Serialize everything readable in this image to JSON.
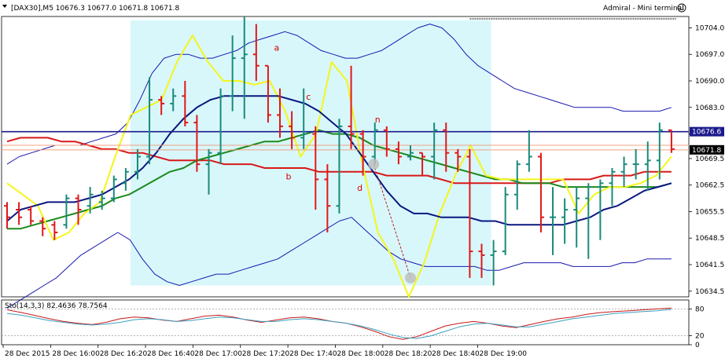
{
  "window": {
    "title": "[DAX30],M5  10676.3 10677.0 10671.8 10671.8",
    "terminal_label": "Admiral - Mini terminal"
  },
  "colors": {
    "up_candle": "#1a8a7a",
    "down_candle": "#e01818",
    "highlight": "#d8f7fb",
    "bb": "#1818b0",
    "ma_navy": "#0a1880",
    "ma_red": "#d81818",
    "ma_green": "#1a8a1a",
    "ma_yellow": "#f5f51a",
    "hline_navy": "#1a1a8c",
    "hline_salmon": "#f0a080",
    "sto_main": "#c81818",
    "sto_signal": "#3aa0c0",
    "grid": "#9a9a9a"
  },
  "chart_data": [
    {
      "type": "candlestick",
      "symbol": "DAX30",
      "timeframe": "M5",
      "ylim": [
        10633,
        10707
      ],
      "yticks": [
        10704.0,
        10697.0,
        10690.0,
        10683.0,
        10676.0,
        10669.5,
        10662.5,
        10655.5,
        10648.5,
        10641.5,
        10634.5
      ],
      "xticks": [
        {
          "label": "28 Dec 2015",
          "index": 0
        },
        {
          "label": "28 Dec 16:00",
          "index": 4
        },
        {
          "label": "28 Dec 16:20",
          "index": 8
        },
        {
          "label": "28 Dec 16:40",
          "index": 12
        },
        {
          "label": "28 Dec 17:00",
          "index": 16
        },
        {
          "label": "28 Dec 17:20",
          "index": 20
        },
        {
          "label": "28 Dec 17:40",
          "index": 24
        },
        {
          "label": "28 Dec 18:00",
          "index": 28
        },
        {
          "label": "28 Dec 18:20",
          "index": 32
        },
        {
          "label": "28 Dec 18:40",
          "index": 36
        },
        {
          "label": "28 Dec 19:00",
          "index": 40
        }
      ],
      "candles": [
        {
          "o": 10657,
          "h": 10658,
          "l": 10651,
          "c": 10654
        },
        {
          "o": 10656,
          "h": 10658,
          "l": 10652,
          "c": 10654
        },
        {
          "o": 10656,
          "h": 10657,
          "l": 10652,
          "c": 10653
        },
        {
          "o": 10653,
          "h": 10654,
          "l": 10649,
          "c": 10651
        },
        {
          "o": 10652,
          "h": 10653,
          "l": 10648,
          "c": 10650
        },
        {
          "o": 10652,
          "h": 10660,
          "l": 10651,
          "c": 10659
        },
        {
          "o": 10659,
          "h": 10660,
          "l": 10652,
          "c": 10656
        },
        {
          "o": 10657,
          "h": 10662,
          "l": 10655,
          "c": 10660
        },
        {
          "o": 10658,
          "h": 10661,
          "l": 10656,
          "c": 10659
        },
        {
          "o": 10659,
          "h": 10665,
          "l": 10658,
          "c": 10664
        },
        {
          "o": 10663,
          "h": 10667,
          "l": 10661,
          "c": 10666
        },
        {
          "o": 10666,
          "h": 10672,
          "l": 10664,
          "c": 10670
        },
        {
          "o": 10670,
          "h": 10691,
          "l": 10668,
          "c": 10685
        },
        {
          "o": 10685,
          "h": 10686,
          "l": 10681,
          "c": 10684
        },
        {
          "o": 10684,
          "h": 10688,
          "l": 10682,
          "c": 10686
        },
        {
          "o": 10686,
          "h": 10690,
          "l": 10678,
          "c": 10679
        },
        {
          "o": 10679,
          "h": 10681,
          "l": 10666,
          "c": 10668
        },
        {
          "o": 10668,
          "h": 10672,
          "l": 10660,
          "c": 10671
        },
        {
          "o": 10671,
          "h": 10688,
          "l": 10668,
          "c": 10686
        },
        {
          "o": 10686,
          "h": 10702,
          "l": 10682,
          "c": 10696
        },
        {
          "o": 10696,
          "h": 10707,
          "l": 10680,
          "c": 10697
        },
        {
          "o": 10697,
          "h": 10705,
          "l": 10690,
          "c": 10694
        },
        {
          "o": 10694,
          "h": 10694,
          "l": 10679,
          "c": 10681
        },
        {
          "o": 10681,
          "h": 10688,
          "l": 10675,
          "c": 10678
        },
        {
          "o": 10678,
          "h": 10682,
          "l": 10672,
          "c": 10675
        }
      ],
      "candles_right": [
        {
          "o": 10675,
          "h": 10688,
          "l": 10672,
          "c": 10676
        },
        {
          "o": 10676,
          "h": 10678,
          "l": 10656,
          "c": 10664
        },
        {
          "o": 10664,
          "h": 10668,
          "l": 10650,
          "c": 10657
        },
        {
          "o": 10657,
          "h": 10680,
          "l": 10655,
          "c": 10678
        },
        {
          "o": 10678,
          "h": 10694,
          "l": 10672,
          "c": 10676
        },
        {
          "o": 10676,
          "h": 10677,
          "l": 10665,
          "c": 10670
        },
        {
          "o": 10670,
          "h": 10679,
          "l": 10668,
          "c": 10677
        },
        {
          "o": 10677,
          "h": 10678,
          "l": 10670,
          "c": 10672
        },
        {
          "o": 10672,
          "h": 10674,
          "l": 10668,
          "c": 10670
        },
        {
          "o": 10670,
          "h": 10673,
          "l": 10669,
          "c": 10671
        },
        {
          "o": 10671,
          "h": 10671,
          "l": 10665,
          "c": 10670
        },
        {
          "o": 10670,
          "h": 10679,
          "l": 10664,
          "c": 10677
        },
        {
          "o": 10677,
          "h": 10679,
          "l": 10666,
          "c": 10671
        },
        {
          "o": 10671,
          "h": 10672,
          "l": 10666,
          "c": 10670
        },
        {
          "o": 10670,
          "h": 10672,
          "l": 10638,
          "c": 10645
        },
        {
          "o": 10645,
          "h": 10647,
          "l": 10638,
          "c": 10644
        },
        {
          "o": 10644,
          "h": 10648,
          "l": 10636,
          "c": 10645
        },
        {
          "o": 10645,
          "h": 10662,
          "l": 10644,
          "c": 10660
        },
        {
          "o": 10660,
          "h": 10669,
          "l": 10656,
          "c": 10668
        },
        {
          "o": 10668,
          "h": 10677,
          "l": 10666,
          "c": 10670
        },
        {
          "o": 10670,
          "h": 10671,
          "l": 10650,
          "c": 10654
        },
        {
          "o": 10654,
          "h": 10662,
          "l": 10644,
          "c": 10654
        },
        {
          "o": 10654,
          "h": 10659,
          "l": 10647,
          "c": 10656
        },
        {
          "o": 10656,
          "h": 10662,
          "l": 10646,
          "c": 10659
        },
        {
          "o": 10659,
          "h": 10663,
          "l": 10643,
          "c": 10662
        },
        {
          "o": 10662,
          "h": 10664,
          "l": 10648,
          "c": 10663
        },
        {
          "o": 10663,
          "h": 10667,
          "l": 10657,
          "c": 10666
        },
        {
          "o": 10666,
          "h": 10670,
          "l": 10662,
          "c": 10668
        },
        {
          "o": 10668,
          "h": 10672,
          "l": 10664,
          "c": 10668
        },
        {
          "o": 10668,
          "h": 10674,
          "l": 10661,
          "c": 10669
        },
        {
          "o": 10669,
          "h": 10679,
          "l": 10664,
          "c": 10677
        },
        {
          "o": 10677,
          "h": 10677,
          "l": 10671,
          "c": 10672
        }
      ],
      "highlight_range": {
        "x_start": 10.4,
        "x_end": 40.8,
        "y_low": 10636,
        "y_high": 10706
      },
      "bollinger_upper": [
        10668,
        10670,
        10671,
        10672,
        10673,
        10673,
        10673,
        10674,
        10675,
        10676,
        10679,
        10685,
        10692,
        10696,
        10697,
        10697,
        10696,
        10696,
        10697,
        10698,
        10700,
        10701,
        10702,
        10703,
        10702,
        10700,
        10698,
        10697,
        10696,
        10696,
        10697,
        10698,
        10700,
        10702,
        10704,
        10705,
        10704,
        10701,
        10697,
        10694,
        10692,
        10690,
        10688,
        10687,
        10686,
        10685,
        10684,
        10683,
        10683,
        10683,
        10683,
        10682,
        10682,
        10682,
        10682,
        10683
      ],
      "bollinger_lower": [
        10630,
        10632,
        10634,
        10636,
        10638,
        10641,
        10644,
        10646,
        10648,
        10650,
        10648,
        10643,
        10639,
        10637,
        10636,
        10637,
        10638,
        10639,
        10639,
        10640,
        10641,
        10642,
        10643,
        10645,
        10647,
        10649,
        10651,
        10653,
        10654,
        10651,
        10648,
        10645,
        10643,
        10642,
        10641,
        10641,
        10641,
        10641,
        10641,
        10640,
        10640,
        10641,
        10642,
        10642,
        10642,
        10642,
        10641,
        10641,
        10641,
        10641,
        10642,
        10642,
        10643,
        10643,
        10643
      ],
      "ma_navy": [
        10653,
        10656,
        10657,
        10658,
        10658,
        10658,
        10659,
        10660,
        10662,
        10664,
        10667,
        10671,
        10676,
        10680,
        10683,
        10685,
        10686,
        10686,
        10686,
        10686,
        10686,
        10685,
        10684,
        10682,
        10679,
        10676,
        10671,
        10666,
        10661,
        10657,
        10655,
        10655,
        10654,
        10654,
        10654,
        10653,
        10653,
        10652,
        10652,
        10652,
        10652,
        10652,
        10653,
        10654,
        10656,
        10657,
        10659,
        10661,
        10662,
        10663
      ],
      "ma_red": [
        10674,
        10675,
        10675,
        10675,
        10674,
        10674,
        10673,
        10672,
        10672,
        10671,
        10671,
        10670,
        10669,
        10669,
        10669,
        10669,
        10668,
        10668,
        10668,
        10667,
        10667,
        10667,
        10667,
        10666,
        10666,
        10666,
        10666,
        10666,
        10665,
        10665,
        10665,
        10665,
        10664,
        10663,
        10663,
        10663,
        10663,
        10663,
        10663,
        10663,
        10663,
        10664,
        10664,
        10664,
        10665,
        10665,
        10665,
        10666,
        10666,
        10666
      ],
      "ma_green": [
        10651,
        10651,
        10652,
        10653,
        10654,
        10655,
        10656,
        10657,
        10659,
        10660,
        10662,
        10664,
        10666,
        10667,
        10669,
        10670,
        10671,
        10672,
        10673,
        10674,
        10674,
        10675,
        10676,
        10677,
        10676,
        10676,
        10675,
        10673,
        10672,
        10671,
        10670,
        10669,
        10668,
        10667,
        10666,
        10665,
        10664,
        10664,
        10663,
        10663,
        10663,
        10662,
        10662,
        10662,
        10662,
        10662,
        10662,
        10662,
        10662,
        10663
      ],
      "ma_yellow": [
        10663,
        10660,
        10657,
        10648,
        10650,
        10655,
        10658,
        10670,
        10681,
        10683,
        10685,
        10695,
        10702,
        10695,
        10690,
        10690,
        10689,
        10690,
        10682,
        10670,
        10676,
        10695,
        10690,
        10668,
        10650,
        10643,
        10633,
        10642,
        10655,
        10665,
        10673,
        10665,
        10664,
        10664,
        10664,
        10664,
        10664,
        10655,
        10660,
        10662,
        10662,
        10663,
        10665,
        10670
      ],
      "hlines": [
        {
          "value": 10676.6,
          "label": "10676.6",
          "color": "hline_navy"
        },
        {
          "value": 10673.0,
          "label": "",
          "color": "hline_salmon"
        },
        {
          "value": 10671.8,
          "label": "10671.8",
          "color": "hline_salmon"
        }
      ],
      "annotations": [
        {
          "text": "a",
          "x": 22.5,
          "y": 10698
        },
        {
          "text": "b",
          "x": 23.5,
          "y": 10664
        },
        {
          "text": "c",
          "x": 25.2,
          "y": 10685
        },
        {
          "text": "d",
          "x": 29.5,
          "y": 10661
        },
        {
          "text": "n",
          "x": 31.0,
          "y": 10679
        }
      ]
    },
    {
      "type": "line",
      "title": "Sto(14,3,3) 82.4636 78.7564",
      "ylim": [
        0,
        100
      ],
      "yticks": [
        80,
        20,
        0
      ],
      "series": [
        {
          "name": "main",
          "values": [
            78,
            72,
            65,
            58,
            52,
            48,
            45,
            50,
            58,
            62,
            60,
            55,
            52,
            58,
            64,
            66,
            62,
            55,
            50,
            55,
            60,
            62,
            58,
            52,
            48,
            40,
            30,
            18,
            12,
            18,
            30,
            42,
            48,
            52,
            48,
            42,
            38,
            45,
            52,
            58,
            62,
            68,
            72,
            74,
            76,
            78,
            80,
            82
          ]
        },
        {
          "name": "signal",
          "values": [
            70,
            66,
            60,
            54,
            50,
            46,
            44,
            46,
            50,
            56,
            58,
            56,
            52,
            54,
            58,
            62,
            60,
            56,
            52,
            52,
            56,
            58,
            56,
            52,
            48,
            42,
            34,
            24,
            16,
            14,
            20,
            30,
            40,
            46,
            48,
            44,
            40,
            40,
            46,
            52,
            58,
            62,
            66,
            70,
            72,
            74,
            76,
            79
          ]
        }
      ]
    }
  ]
}
